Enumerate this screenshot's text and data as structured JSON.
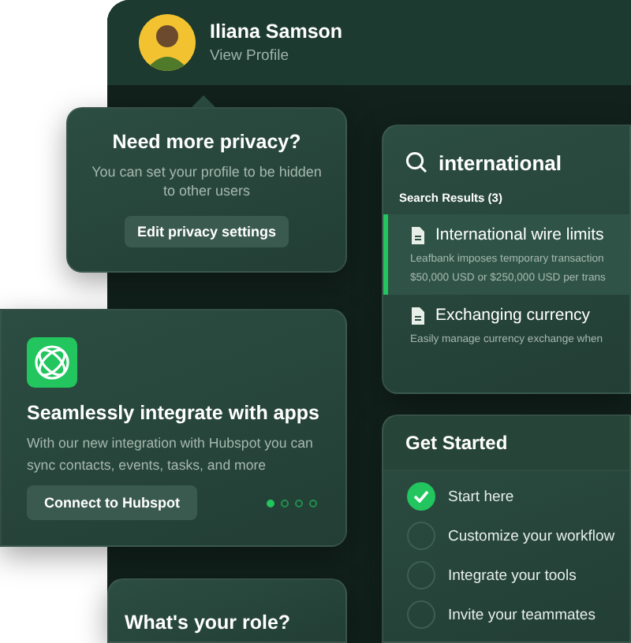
{
  "profile": {
    "name": "Iliana Samson",
    "link": "View Profile"
  },
  "privacy_popover": {
    "title": "Need more privacy?",
    "text": "You can set your profile to be hidden to other users",
    "button": "Edit privacy settings"
  },
  "search": {
    "query": "international",
    "results_label": "Search Results (3)",
    "results": [
      {
        "title": "International wire limits",
        "description_lines": [
          "Leafbank imposes temporary transaction",
          "$50,000 USD or $250,000 USD per trans"
        ],
        "selected": true
      },
      {
        "title": "Exchanging currency",
        "description_lines": [
          "Easily manage currency exchange when"
        ],
        "selected": false
      }
    ]
  },
  "integration_card": {
    "title": "Seamlessly integrate with apps",
    "text": "With our new integration with Hubspot you can sync contacts, events, tasks, and more",
    "button": "Connect to Hubspot",
    "pages": [
      {
        "selected": true
      },
      {
        "selected": false
      },
      {
        "selected": false
      },
      {
        "selected": false
      }
    ]
  },
  "get_started": {
    "title": "Get Started",
    "steps": [
      {
        "label": "Start here",
        "checked": true
      },
      {
        "label": "Customize your workflow",
        "checked": false
      },
      {
        "label": "Integrate your tools",
        "checked": false
      },
      {
        "label": "Invite your teammates",
        "checked": false
      }
    ]
  },
  "role_card": {
    "title": "What's your role?"
  }
}
